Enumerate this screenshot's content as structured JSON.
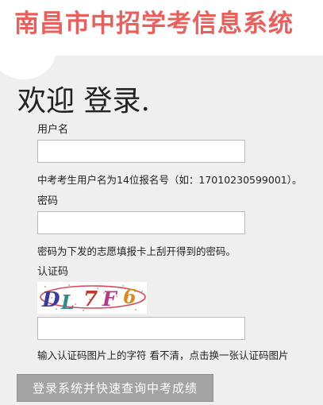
{
  "header": {
    "site_title": "南昌市中招学考信息系统"
  },
  "login": {
    "welcome": "欢迎 登录.",
    "username": {
      "label": "用户名",
      "value": "",
      "hint": "中考考生用户名为14位报名号（如：17010230599001）。"
    },
    "password": {
      "label": "密码",
      "value": "",
      "hint": "密码为下发的志愿填报卡上刮开得到的密码。"
    },
    "captcha": {
      "label": "认证码",
      "image_text": "DL7F6",
      "value": "",
      "hint": "输入认证码图片上的字符 看不清，点击换一张认证码图片"
    },
    "submit_label": "登录系统并快速查询中考成绩"
  },
  "colors": {
    "title_red": "#ea5f5c",
    "panel_bg": "#efefef",
    "button_bg": "#a3a3a3"
  }
}
